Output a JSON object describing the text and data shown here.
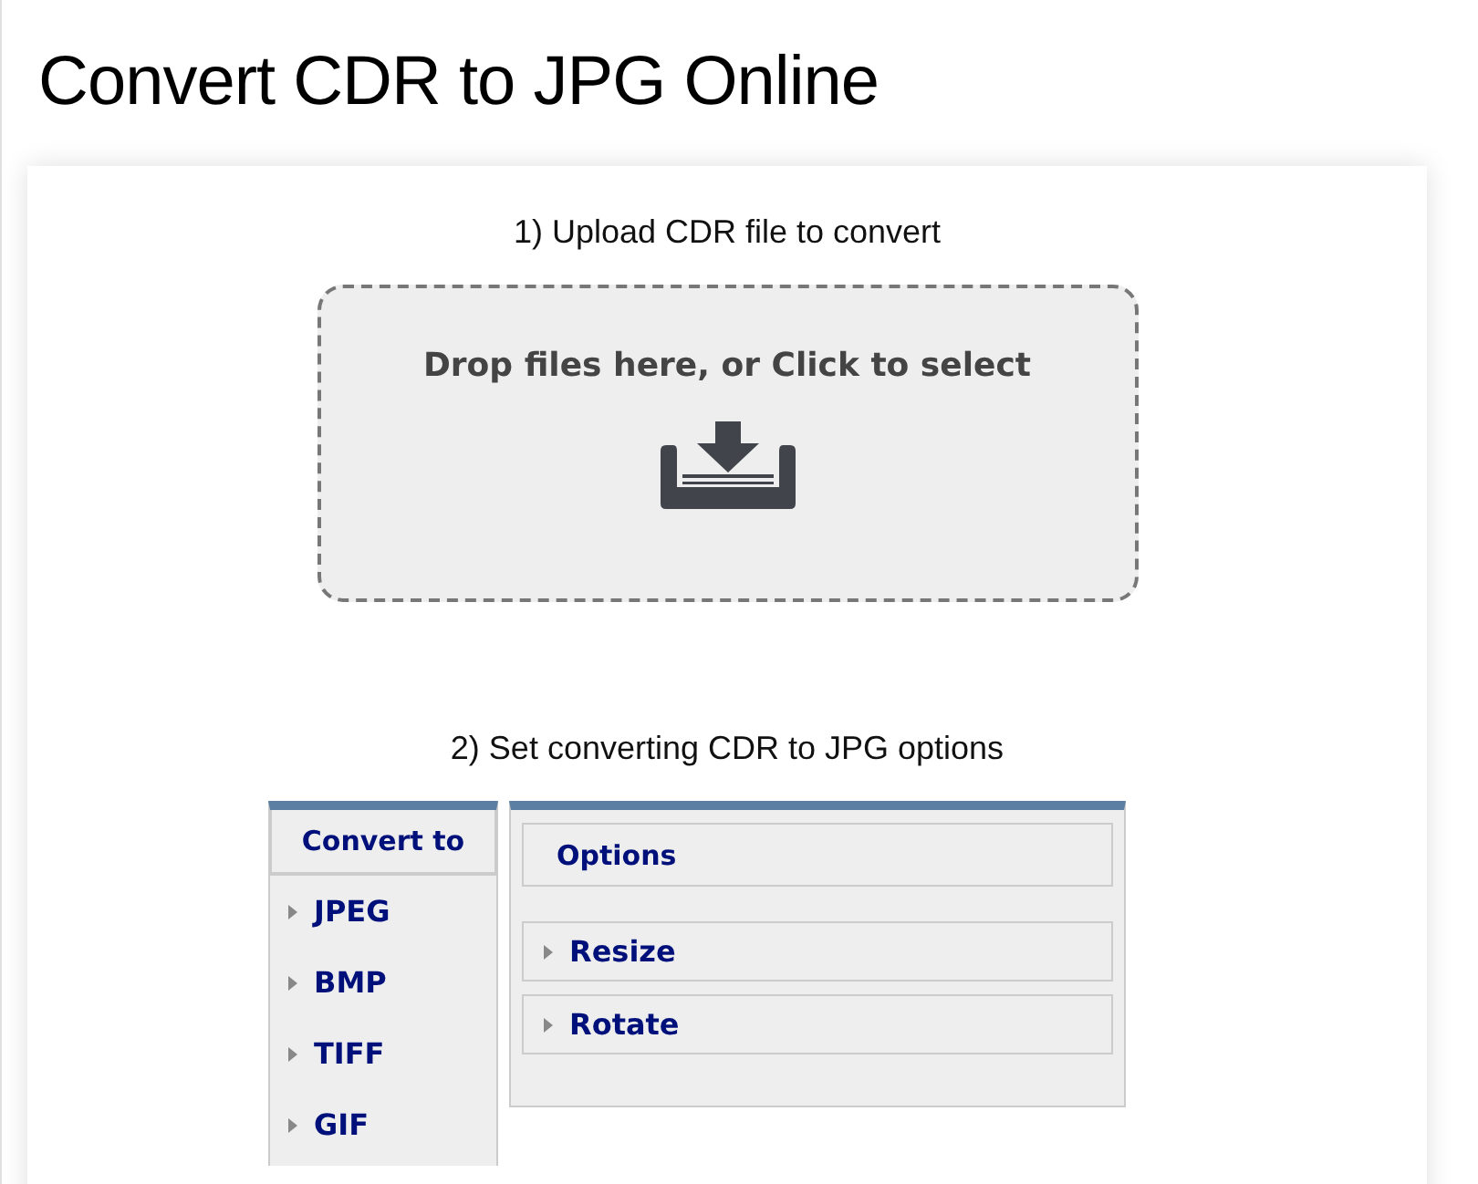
{
  "page": {
    "title": "Convert CDR to JPG Online"
  },
  "upload": {
    "heading": "1) Upload CDR file to convert",
    "dropzone_text": "Drop files here, or Click to select"
  },
  "options_section": {
    "heading": "2) Set converting CDR to JPG options"
  },
  "convert_to": {
    "header": "Convert to",
    "formats": [
      "JPEG",
      "BMP",
      "TIFF",
      "GIF"
    ]
  },
  "options": {
    "header": "Options",
    "groups": [
      {
        "label": "Resize",
        "expanded": false
      },
      {
        "label": "Rotate",
        "expanded": false
      }
    ]
  }
}
